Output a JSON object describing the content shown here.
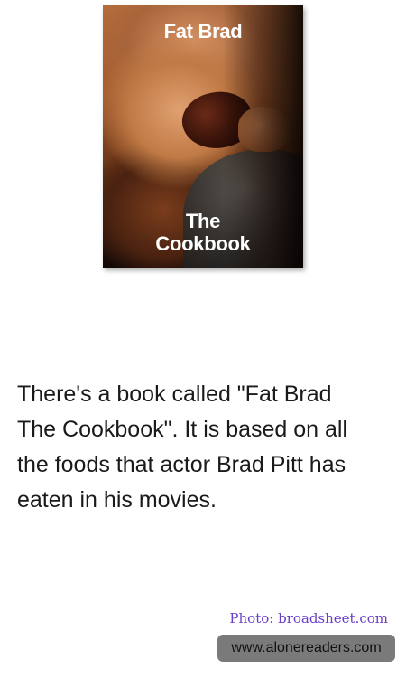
{
  "book": {
    "title": "Fat Brad",
    "subtitle_line1": "The",
    "subtitle_line2": "Cookbook"
  },
  "caption": {
    "lines": [
      "There's a book called \"Fat Brad",
      "The Cookbook\". It is based on all",
      "the foods that actor Brad Pitt has",
      "eaten in his movies."
    ]
  },
  "credit": {
    "photo": "Photo: broadsheet.com",
    "source": "www.alonereaders.com"
  },
  "colors": {
    "credit_text": "#6a3fc8",
    "badge_bg": "#7a7a7a",
    "caption_text": "#1a1a1a"
  }
}
